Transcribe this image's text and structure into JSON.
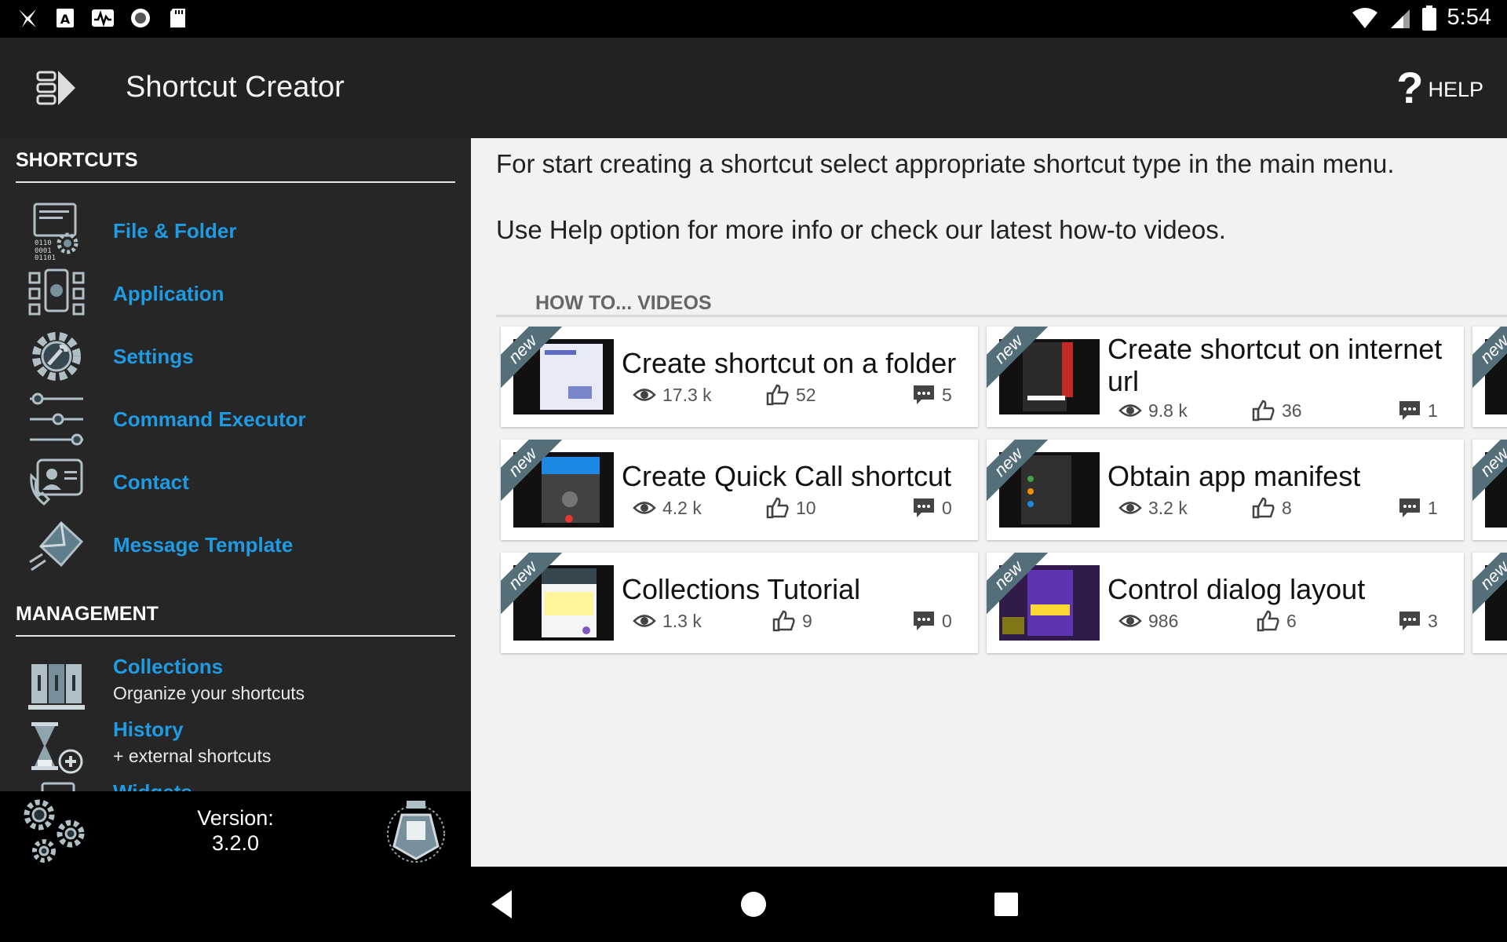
{
  "status_bar": {
    "time": "5:54"
  },
  "app_bar": {
    "title": "Shortcut Creator",
    "help_label": "HELP"
  },
  "drawer": {
    "shortcuts_header": "SHORTCUTS",
    "shortcuts": [
      {
        "label": "File & Folder",
        "icon": "file-folder-icon"
      },
      {
        "label": "Application",
        "icon": "application-icon"
      },
      {
        "label": "Settings",
        "icon": "settings-icon"
      },
      {
        "label": "Command Executor",
        "icon": "command-executor-icon"
      },
      {
        "label": "Contact",
        "icon": "contact-icon"
      },
      {
        "label": "Message Template",
        "icon": "message-template-icon"
      }
    ],
    "management_header": "MANAGEMENT",
    "management": [
      {
        "label": "Collections",
        "sub": "Organize your shortcuts",
        "icon": "collections-icon"
      },
      {
        "label": "History",
        "sub": "+ external shortcuts",
        "icon": "history-icon"
      },
      {
        "label": "Widgets",
        "icon": "widgets-icon"
      }
    ],
    "footer": {
      "version_label": "Version:",
      "version": "3.2.0"
    }
  },
  "main": {
    "intro_1": "For start creating a shortcut select appropriate shortcut type in the main menu.",
    "intro_2": "Use Help option for more info or check our latest how-to videos.",
    "videos_header": "HOW TO... VIDEOS",
    "new_label": "new",
    "videos": [
      {
        "title": "Create shortcut on a folder",
        "views": "17.3 k",
        "likes": "52",
        "comments": "5"
      },
      {
        "title": "Create shortcut on internet url",
        "views": "9.8 k",
        "likes": "36",
        "comments": "1"
      },
      {
        "title": "Create Quick Call shortcut",
        "views": "4.2 k",
        "likes": "10",
        "comments": "0"
      },
      {
        "title": "Obtain app manifest",
        "views": "3.2 k",
        "likes": "8",
        "comments": "1"
      },
      {
        "title": "Collections Tutorial",
        "views": "1.3 k",
        "likes": "9",
        "comments": "0"
      },
      {
        "title": "Control dialog layout",
        "views": "986",
        "likes": "6",
        "comments": "3"
      }
    ]
  },
  "colors": {
    "accent": "#1e9be3",
    "appbar": "#222222",
    "drawer": "#262626",
    "content": "#f2f2f2",
    "ribbon": "#546e7a"
  }
}
